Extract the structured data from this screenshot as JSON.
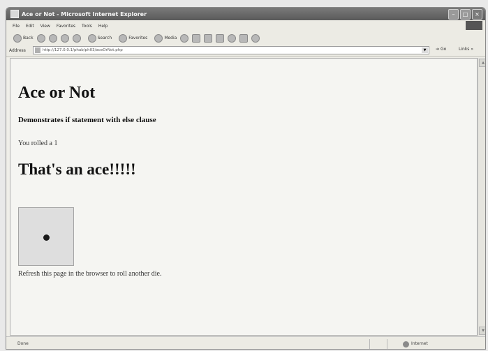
{
  "window": {
    "title": "Ace or Not - Microsoft Internet Explorer"
  },
  "menubar": {
    "items": [
      "File",
      "Edit",
      "View",
      "Favorites",
      "Tools",
      "Help"
    ]
  },
  "toolbar": {
    "back": "Back",
    "search": "Search",
    "favorites": "Favorites",
    "media": "Media"
  },
  "address": {
    "label": "Address",
    "url": "http://127.0.0.1/phab/ph03/aceOrNot.php",
    "go": "Go",
    "links": "Links"
  },
  "page": {
    "heading": "Ace or Not",
    "subheading": "Demonstrates if statement with else clause",
    "rolled": "You rolled a 1",
    "result": "That's an ace!!!!!",
    "refresh": "Refresh this page in the browser to roll another die."
  },
  "status": {
    "text": "Done",
    "zone": "Internet"
  }
}
